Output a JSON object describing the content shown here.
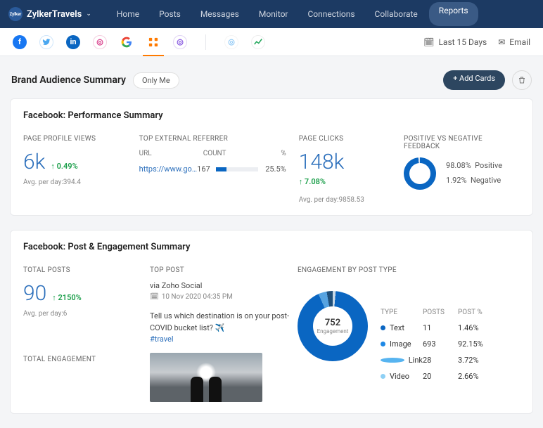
{
  "header": {
    "brand": "ZylkerTravels",
    "nav": [
      "Home",
      "Posts",
      "Messages",
      "Monitor",
      "Connections",
      "Collaborate",
      "Reports"
    ],
    "active_nav": "Reports"
  },
  "iconbar": {
    "date_range": "Last 15 Days",
    "email": "Email"
  },
  "page": {
    "title": "Brand Audience Summary",
    "scope": "Only Me",
    "add_cards": "+ Add Cards"
  },
  "facebook_perf": {
    "title": "Facebook: Performance Summary",
    "profile_views": {
      "label": "PAGE PROFILE VIEWS",
      "value": "6k",
      "delta": "↑ 0.49%",
      "avg_label": "Avg. per day:",
      "avg_value": "394.4"
    },
    "referrer": {
      "label": "TOP EXTERNAL REFERRER",
      "headers": {
        "url": "URL",
        "count": "COUNT",
        "pct": "%"
      },
      "url": "https://www.go…",
      "count": "167",
      "pct": "25.5%"
    },
    "clicks": {
      "label": "PAGE CLICKS",
      "value": "148k",
      "delta": "↑ 7.08%",
      "avg_label": "Avg. per day:",
      "avg_value": "9858.53"
    },
    "feedback": {
      "label": "POSITIVE VS NEGATIVE FEEDBACK",
      "positive_pct": "98.08%",
      "positive_label": "Positive",
      "negative_pct": "1.92%",
      "negative_label": "Negative"
    }
  },
  "facebook_post": {
    "title": "Facebook: Post & Engagement Summary",
    "totals": {
      "label": "TOTAL POSTS",
      "value": "90",
      "delta": "↑ 2150%",
      "avg_label": "Avg. per day:",
      "avg_value": "6",
      "engagement_label": "TOTAL ENGAGEMENT"
    },
    "top_post": {
      "label": "TOP POST",
      "source": "via Zoho Social",
      "date": "10 Nov 2020 04:35 PM",
      "text": "Tell us which destination is on your post-COVID bucket list? ✈️",
      "hashtag": "#travel"
    },
    "engagement": {
      "label": "ENGAGEMENT BY POST TYPE",
      "center_value": "752",
      "center_label": "Engagement",
      "headers": {
        "type": "TYPE",
        "posts": "POSTS",
        "pct": "POST %"
      },
      "rows": [
        {
          "type": "Text",
          "posts": "11",
          "pct": "1.46%"
        },
        {
          "type": "Image",
          "posts": "693",
          "pct": "92.15%"
        },
        {
          "type": "Link",
          "posts": "28",
          "pct": "3.72%"
        },
        {
          "type": "Video",
          "posts": "20",
          "pct": "2.66%"
        }
      ]
    }
  },
  "chart_data": [
    {
      "type": "pie",
      "title": "Positive vs Negative Feedback",
      "series": [
        {
          "name": "Positive",
          "value": 98.08
        },
        {
          "name": "Negative",
          "value": 1.92
        }
      ]
    },
    {
      "type": "pie",
      "title": "Engagement by Post Type",
      "center_value": 752,
      "series": [
        {
          "name": "Text",
          "posts": 11,
          "pct": 1.46
        },
        {
          "name": "Image",
          "posts": 693,
          "pct": 92.15
        },
        {
          "name": "Link",
          "posts": 28,
          "pct": 3.72
        },
        {
          "name": "Video",
          "posts": 20,
          "pct": 2.66
        }
      ]
    },
    {
      "type": "bar",
      "title": "Top External Referrer",
      "categories": [
        "https://www.go…"
      ],
      "values": [
        167
      ],
      "pct": [
        25.5
      ]
    }
  ]
}
